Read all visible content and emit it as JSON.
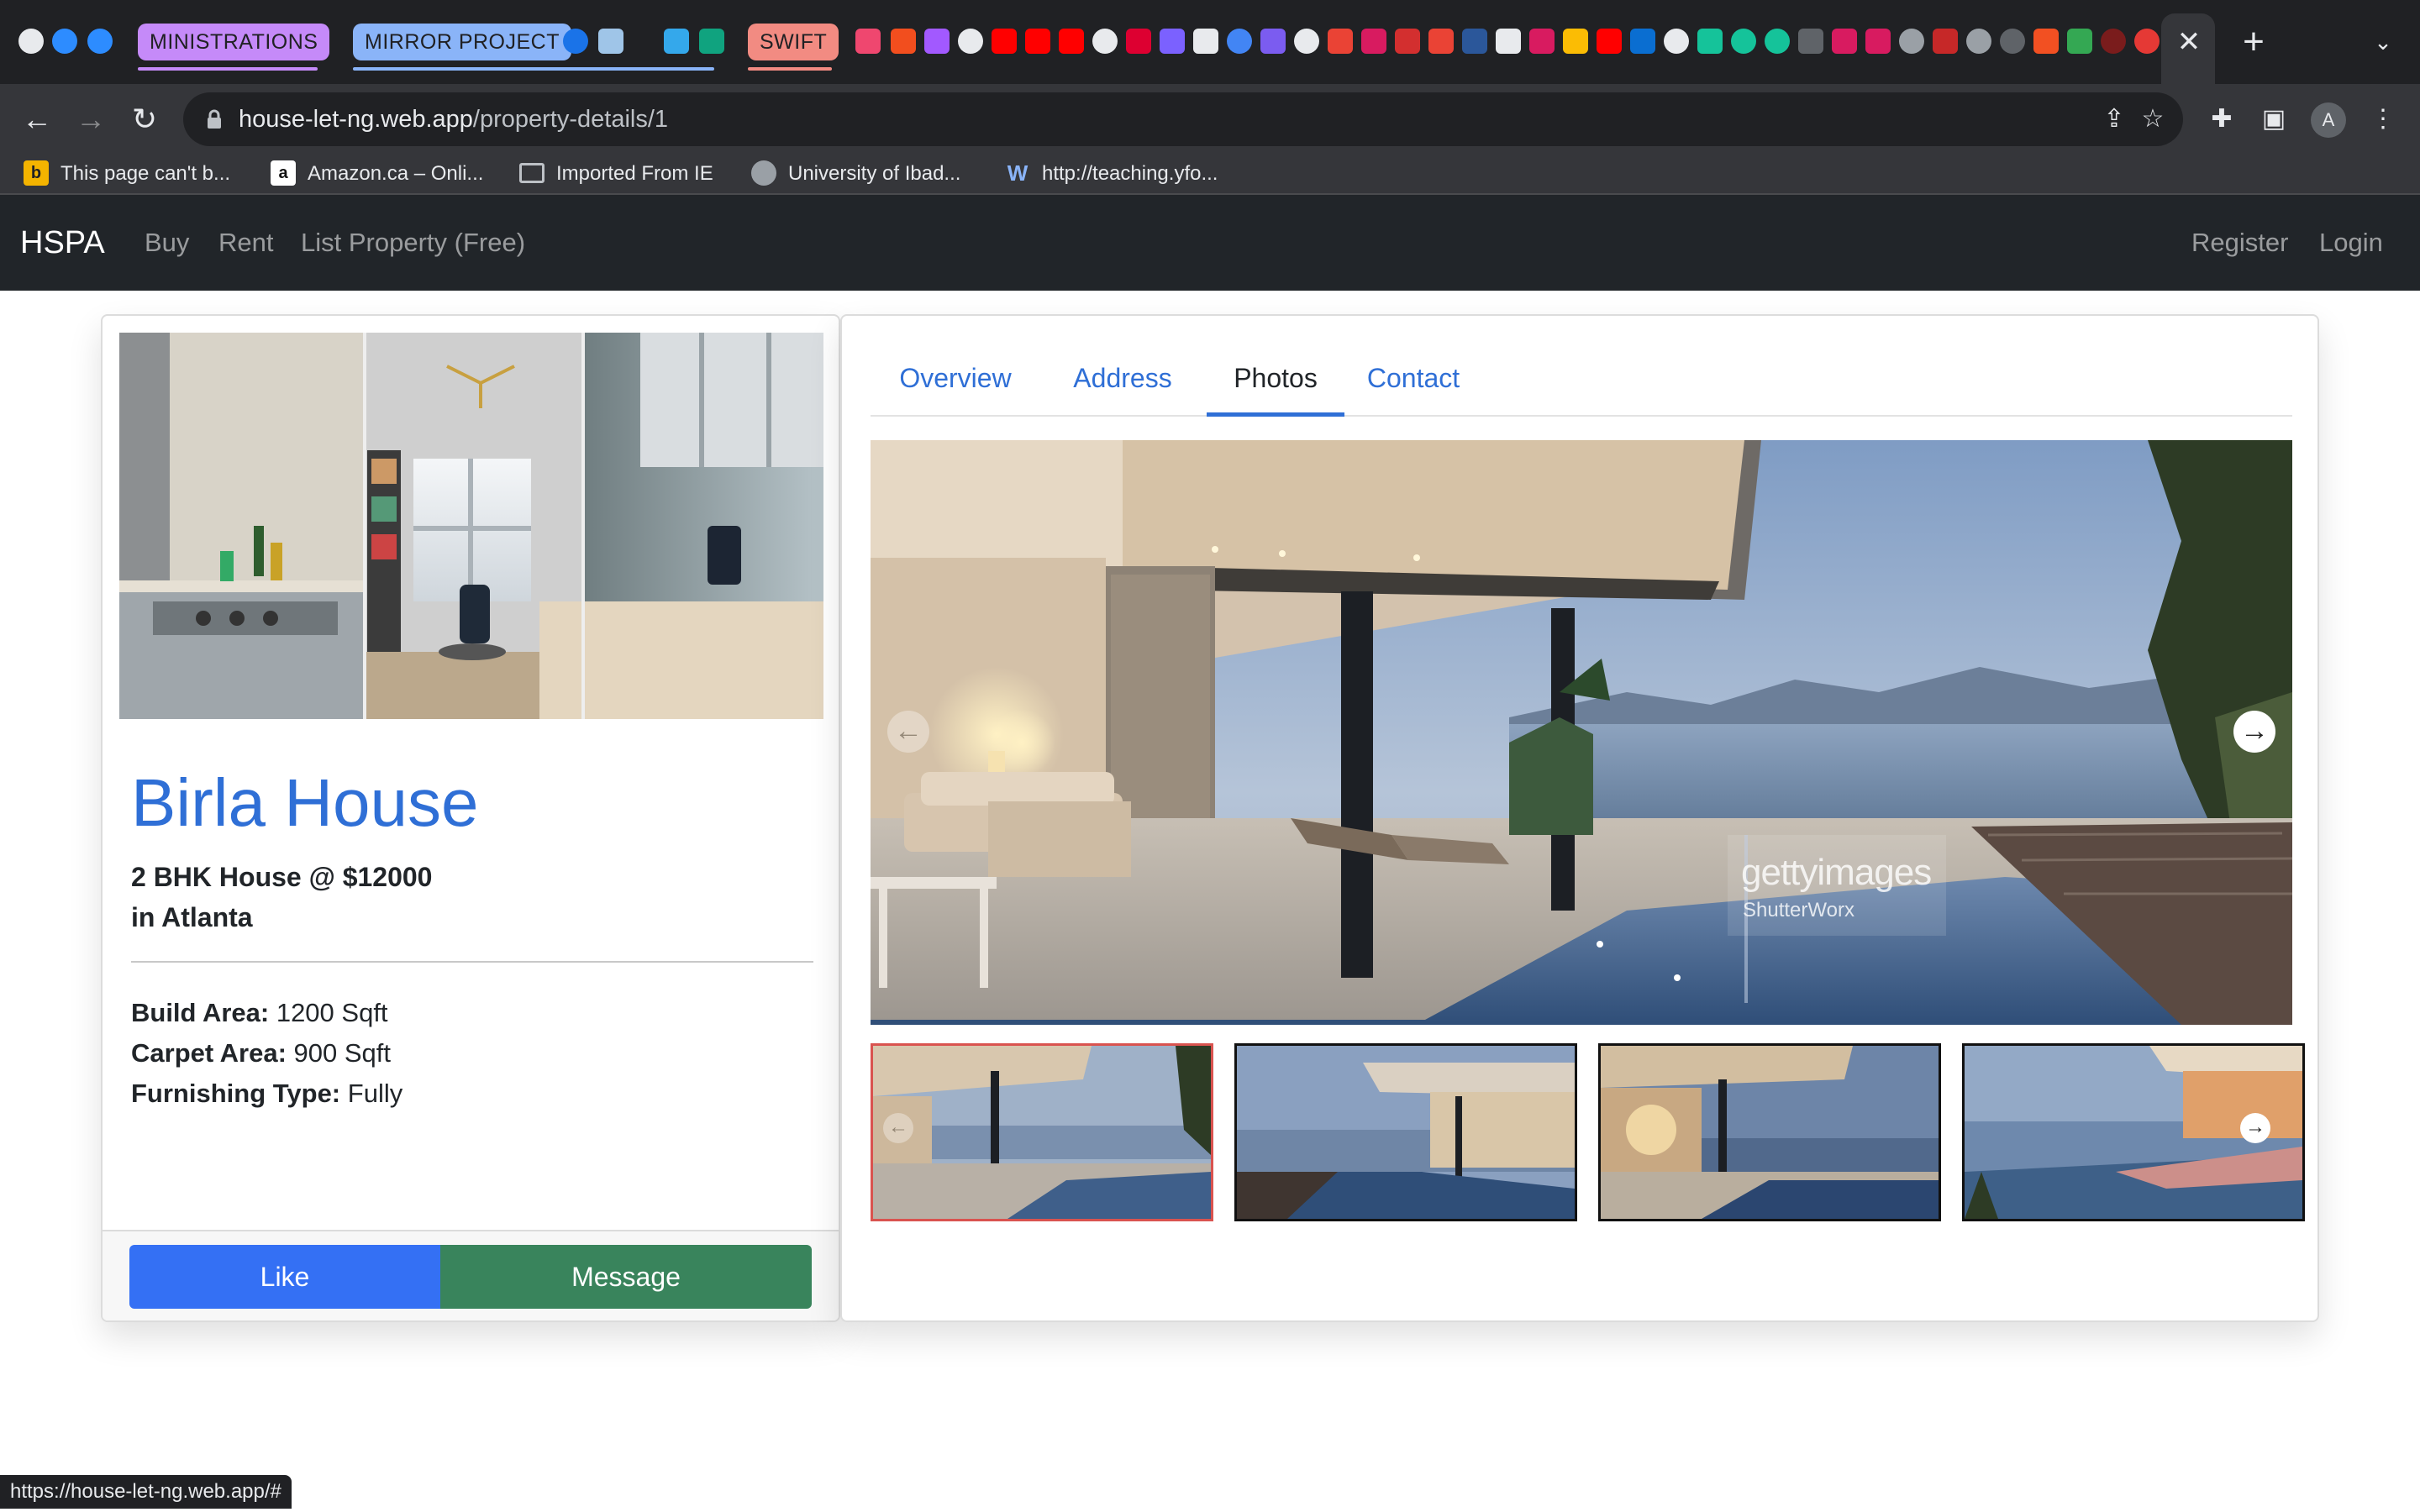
{
  "browser": {
    "tab_groups": [
      {
        "label": "MINISTRATIONS",
        "color": "#c58af9"
      },
      {
        "label": "MIRROR PROJECT",
        "color": "#8ab4f8"
      },
      {
        "label": "SWIFT",
        "color": "#f28b82"
      }
    ],
    "url_host": "house-let-ng.web.app",
    "url_path": "/property-details/1",
    "profile_initial": "A",
    "bookmarks": [
      {
        "label": "This page can't b...",
        "icon": "bing-icon"
      },
      {
        "label": "Amazon.ca – Onli...",
        "icon": "amazon-icon"
      },
      {
        "label": "Imported From IE",
        "icon": "folder-icon"
      },
      {
        "label": "University of Ibad...",
        "icon": "globe-icon"
      },
      {
        "label": "http://teaching.yfo...",
        "icon": "w-logo-icon"
      }
    ],
    "status_url": "https://house-let-ng.web.app/#"
  },
  "navbar": {
    "brand": "HSPA",
    "links": [
      "Buy",
      "Rent",
      "List Property (Free)"
    ],
    "right_links": [
      "Register",
      "Login"
    ]
  },
  "property": {
    "name": "Birla House",
    "summary": "2 BHK House @ $12000",
    "location": "in Atlanta",
    "specs": [
      {
        "label": "Build Area:",
        "value": "1200 Sqft"
      },
      {
        "label": "Carpet Area:",
        "value": "900 Sqft"
      },
      {
        "label": "Furnishing Type:",
        "value": "Fully"
      }
    ],
    "like_label": "Like",
    "message_label": "Message"
  },
  "details_tabs": {
    "items": [
      "Overview",
      "Address",
      "Photos",
      "Contact"
    ],
    "active": "Photos"
  },
  "gallery": {
    "watermark_brand": "gettyimages",
    "watermark_credit": "ShutterWorx",
    "thumbnail_count": 4,
    "selected_index": 0
  }
}
